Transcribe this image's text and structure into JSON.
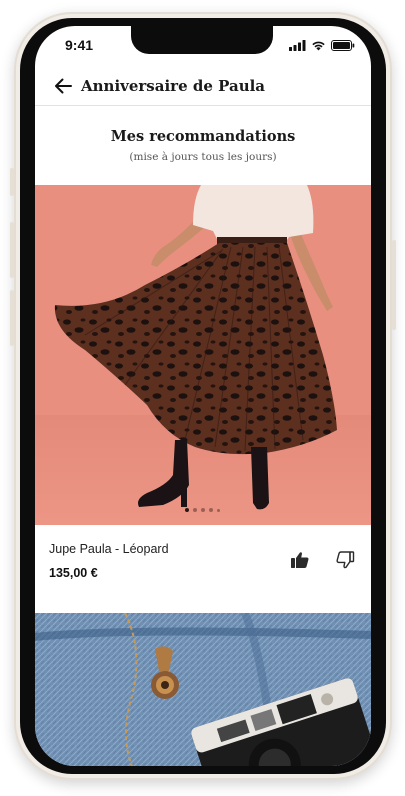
{
  "status_bar": {
    "time": "9:41",
    "icons": [
      "signal-icon",
      "wifi-icon",
      "battery-icon"
    ]
  },
  "header": {
    "title": "Anniversaire de Paula",
    "back_icon": "arrow-left-icon"
  },
  "section": {
    "title": "Mes recommandations",
    "subtitle": "(mise à jours tous les jours)"
  },
  "product": {
    "name": "Jupe Paula - Léopard",
    "price": "135,00 €",
    "image_count": 5,
    "active_image": 1,
    "like_icon": "thumbs-up-icon",
    "dislike_icon": "thumbs-down-icon"
  },
  "colors": {
    "image_background": "#e98f80",
    "skirt": "#5a2e1e",
    "text": "#1a1a1a",
    "denim": "#6f8fb3"
  }
}
